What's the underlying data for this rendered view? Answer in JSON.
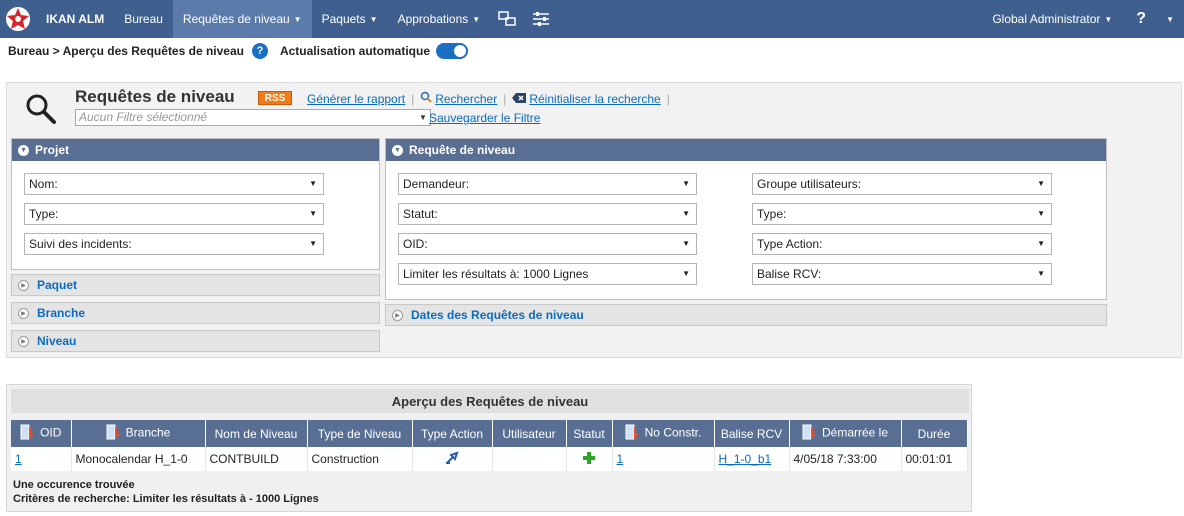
{
  "nav": {
    "brand": "IKAN ALM",
    "items": [
      {
        "label": "Bureau",
        "caret": ""
      },
      {
        "label": "Requêtes de niveau",
        "caret": "▼"
      },
      {
        "label": "Paquets",
        "caret": "▼"
      },
      {
        "label": "Approbations",
        "caret": "▼"
      }
    ],
    "user": "Global Administrator",
    "user_caret": "▼",
    "help": "?",
    "more_caret": "▼"
  },
  "breadcrumb": {
    "text": "Bureau > Aperçu des Requêtes de niveau",
    "help": "?",
    "auto_refresh_label": "Actualisation automatique",
    "auto_refresh_on": true
  },
  "search": {
    "title": "Requêtes de niveau",
    "rss": "RSS",
    "generate_report": "Générer le rapport",
    "search": "Rechercher",
    "reset": "Réinitialiser la recherche",
    "filter_placeholder": "Aucun Filtre sélectionné",
    "save_filter": "Sauvegarder le Filtre",
    "projet": {
      "title": "Projet",
      "fields": [
        "Nom:",
        "Type:",
        "Suivi des incidents:"
      ]
    },
    "collapsed": [
      "Paquet",
      "Branche",
      "Niveau"
    ],
    "requete": {
      "title": "Requête de niveau",
      "left_fields": [
        "Demandeur:",
        "Statut:",
        "OID:",
        "Limiter les résultats à: 1000 Lignes"
      ],
      "right_fields": [
        "Groupe utilisateurs:",
        "Type:",
        "Type Action:",
        "Balise RCV:"
      ]
    },
    "dates_title": "Dates des Requêtes de niveau"
  },
  "results": {
    "title": "Aperçu des Requêtes de niveau",
    "columns": [
      "OID",
      "Branche",
      "Nom de Niveau",
      "Type de Niveau",
      "Type Action",
      "Utilisateur",
      "Statut",
      "No Constr.",
      "Balise RCV",
      "Démarrée le",
      "Durée"
    ],
    "rows": [
      {
        "oid": "1",
        "branche": "Monocalendar H_1-0",
        "nom_niveau": "CONTBUILD",
        "type_niveau": "Construction",
        "type_action_icon": "build-action-icon",
        "utilisateur": "",
        "statut_icon": "success-plus-icon",
        "no_constr": "1",
        "balise_rcv": "H_1-0_b1",
        "demarree": "4/05/18 7:33:00",
        "duree": "00:01:01"
      }
    ],
    "footer_count": "Une occurence trouvée",
    "footer_criteria": "Critères de recherche: Limiter les résultats à - 1000 Lignes"
  },
  "colors": {
    "navbar": "#3f5f8f",
    "section_header": "#586f93",
    "link": "#0b6cbf",
    "rss": "#f07c1b"
  }
}
